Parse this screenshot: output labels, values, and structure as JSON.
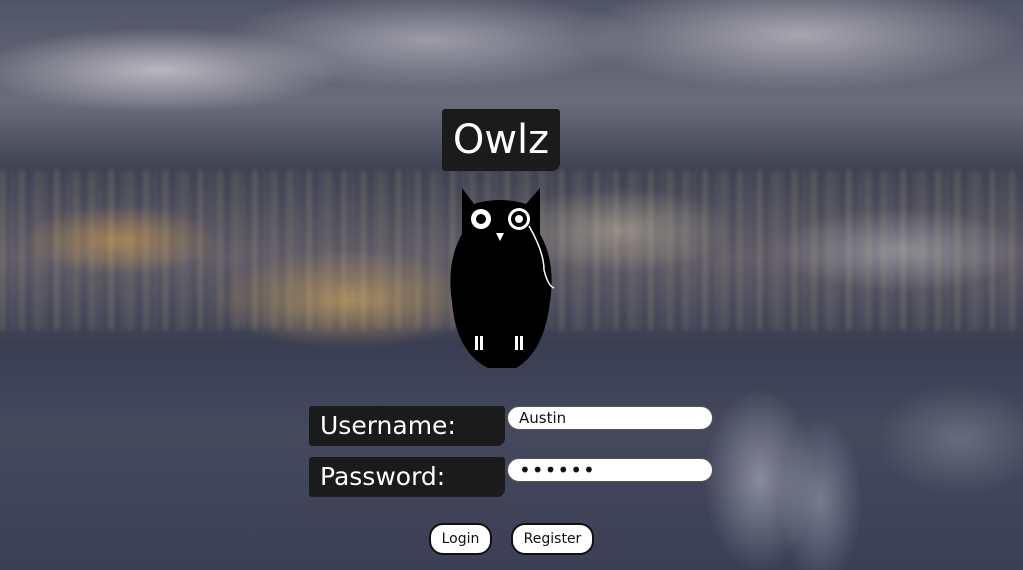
{
  "app": {
    "title": "Owlz"
  },
  "login_form": {
    "username_label": "Username:",
    "username_value": "Austin",
    "password_label": "Password:",
    "password_value": "••••••",
    "login_label": "Login",
    "register_label": "Register"
  },
  "icons": {
    "logo": "owl-monocle-icon"
  },
  "colors": {
    "label_bg": "#1b1b1b",
    "label_text": "#ffffff",
    "field_bg": "#ffffff"
  }
}
